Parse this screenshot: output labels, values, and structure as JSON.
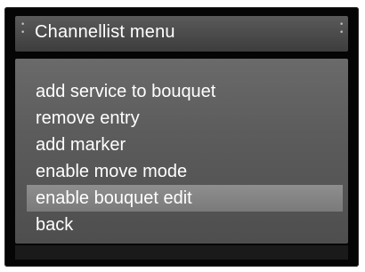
{
  "window": {
    "title": "Channellist menu"
  },
  "menu": {
    "items": [
      {
        "label": "add service to bouquet",
        "selected": false
      },
      {
        "label": "remove entry",
        "selected": false
      },
      {
        "label": "add marker",
        "selected": false
      },
      {
        "label": "enable move mode",
        "selected": false
      },
      {
        "label": "enable bouquet edit",
        "selected": true
      },
      {
        "label": "back",
        "selected": false
      }
    ]
  },
  "colors": {
    "frame": "#050505",
    "title_bar": "#4a4a4a",
    "panel": "#5c5c5c",
    "selection": "#858585",
    "text": "#ffffff"
  }
}
